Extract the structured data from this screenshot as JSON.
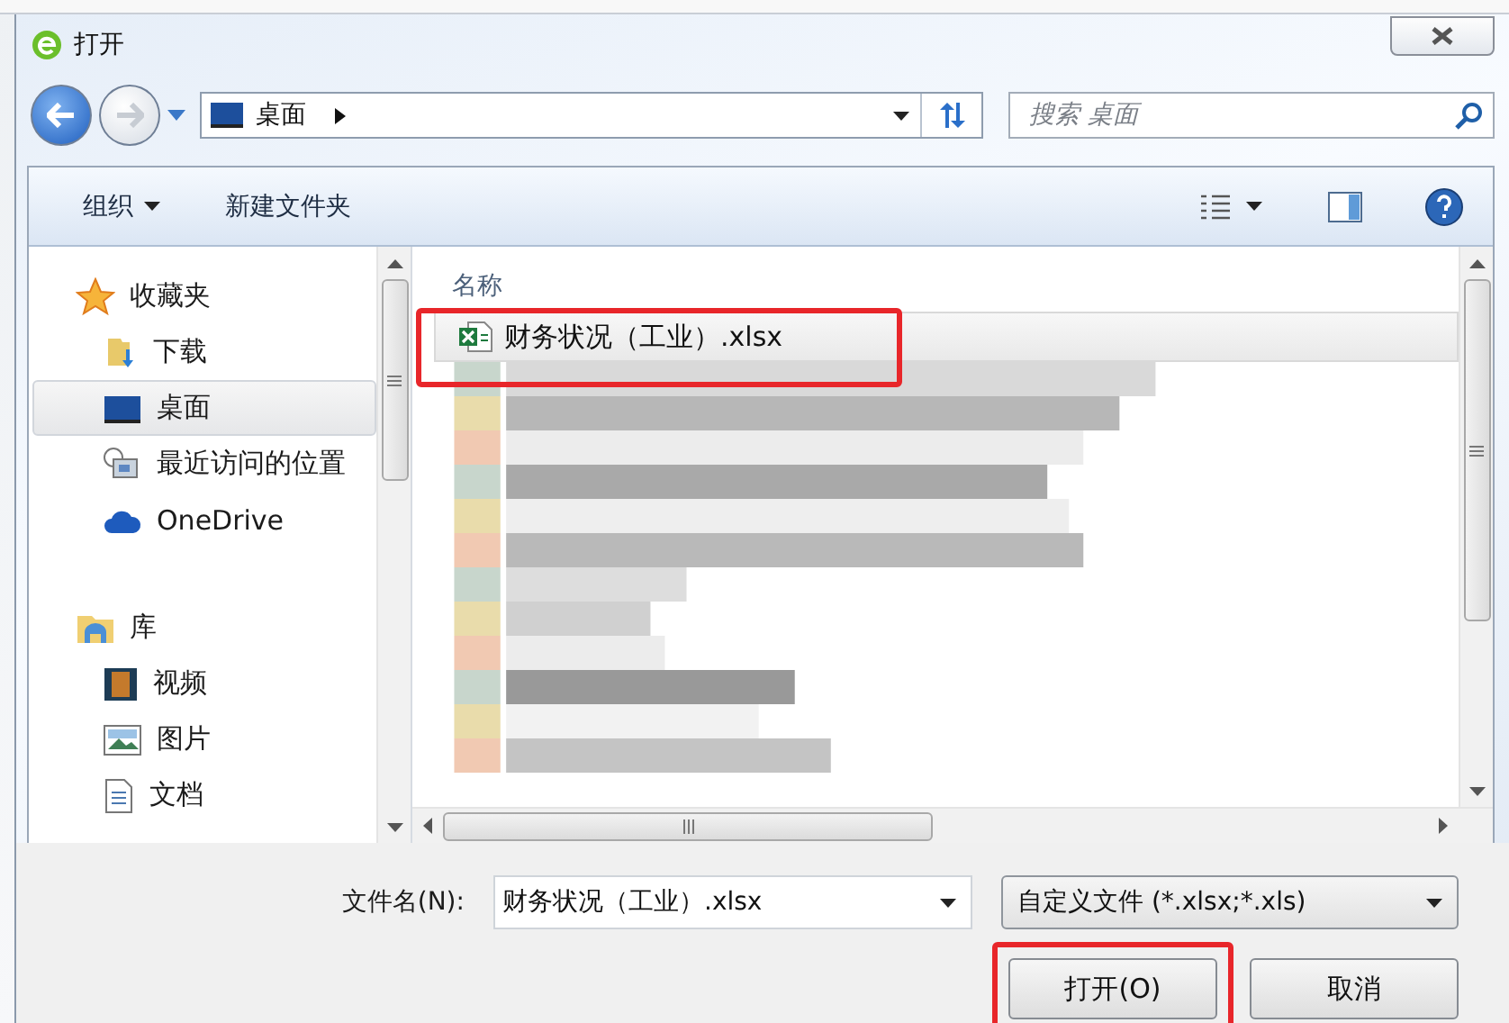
{
  "window": {
    "title": "打开"
  },
  "nav": {
    "location": "桌面",
    "search_placeholder": "搜索 桌面"
  },
  "toolbar": {
    "organize": "组织",
    "new_folder": "新建文件夹"
  },
  "sidebar": {
    "groups": [
      {
        "label": "收藏夹",
        "children": [
          {
            "label": "下载",
            "selected": false
          },
          {
            "label": "桌面",
            "selected": true
          },
          {
            "label": "最近访问的位置",
            "selected": false
          },
          {
            "label": "OneDrive",
            "selected": false
          }
        ]
      },
      {
        "label": "库",
        "children": [
          {
            "label": "视频",
            "selected": false
          },
          {
            "label": "图片",
            "selected": false
          },
          {
            "label": "文档",
            "selected": false
          }
        ]
      }
    ]
  },
  "file_list": {
    "column": "名称",
    "files": [
      {
        "name": "财务状况（工业）.xlsx",
        "selected": true,
        "highlighted": true
      }
    ]
  },
  "footer": {
    "filename_label": "文件名(N):",
    "filename": "财务状况（工业）.xlsx",
    "filetype": "自定义文件 (*.xlsx;*.xls)",
    "buttons": [
      {
        "label": "打开(O)",
        "highlighted": true
      },
      {
        "label": "取消",
        "highlighted": false
      }
    ]
  }
}
